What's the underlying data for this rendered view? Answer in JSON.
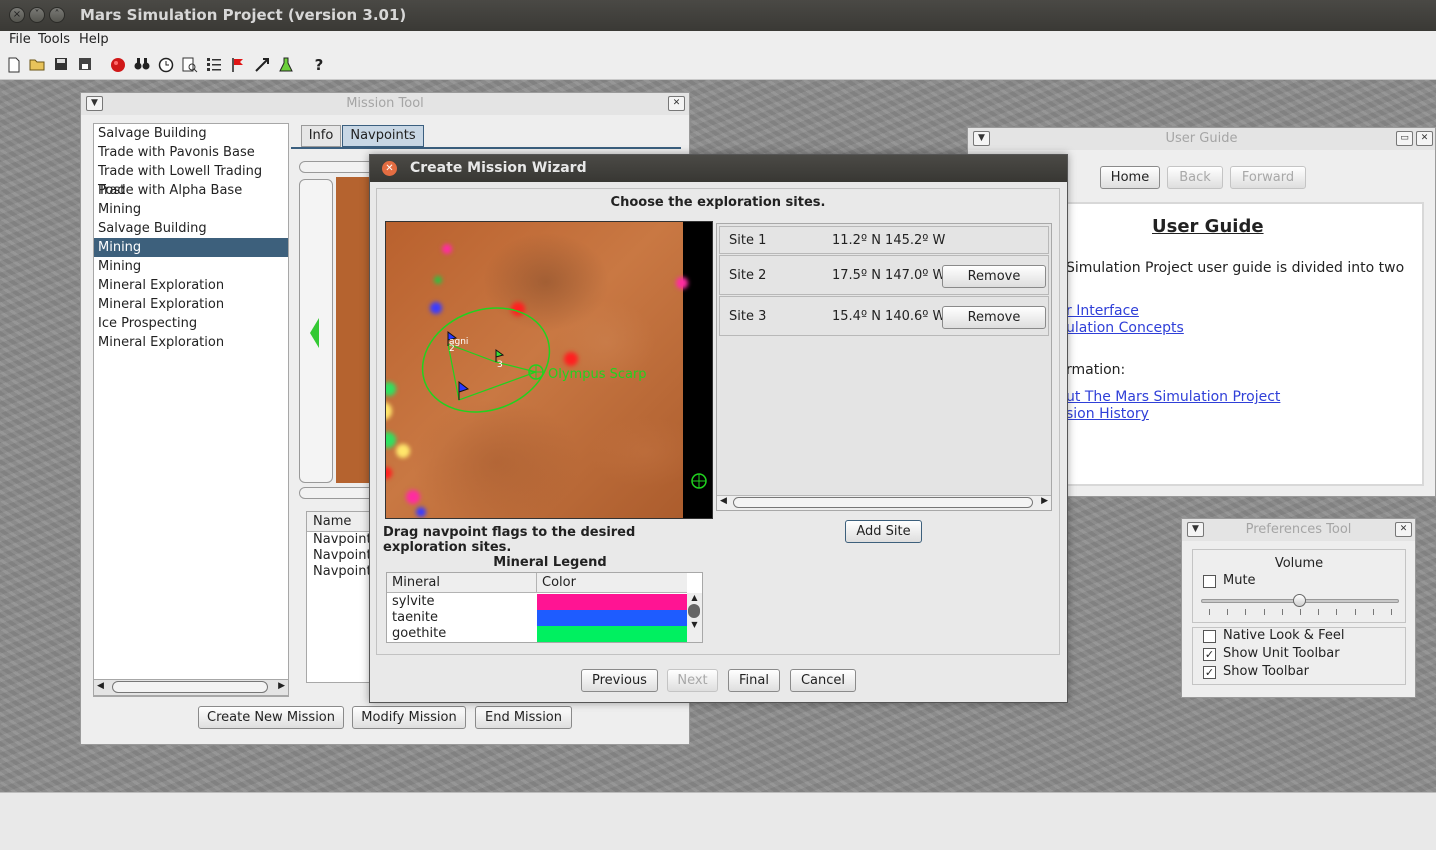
{
  "window": {
    "title": "Mars Simulation Project (version 3.01)"
  },
  "menu": [
    "File",
    "Tools",
    "Help"
  ],
  "toolbar_icons": [
    "new-file-icon",
    "open-folder-icon",
    "save-icon",
    "save-as-icon",
    "mars-globe-icon",
    "binoculars-icon",
    "clock-icon",
    "search-document-icon",
    "list-icon",
    "flag-icon",
    "science-icon",
    "flask-icon",
    "help-icon"
  ],
  "mission_tool": {
    "title": "Mission Tool",
    "missions": [
      "Salvage Building",
      "Trade with Pavonis Base",
      "Trade with Lowell Trading Post",
      "Trade with Alpha Base",
      "Mining",
      "Salvage Building",
      "Mining",
      "Mining",
      "Mineral Exploration",
      "Mineral Exploration",
      "Ice Prospecting",
      "Mineral Exploration"
    ],
    "selected_index": 6,
    "tabs": [
      "Info",
      "Navpoints"
    ],
    "table_header": "Name",
    "rows": [
      "Navpoint",
      "Navpoint",
      "Navpoint"
    ],
    "buttons": {
      "create": "Create New Mission",
      "modify": "Modify Mission",
      "end": "End Mission"
    }
  },
  "user_guide": {
    "title": "User Guide",
    "nav": {
      "home": "Home",
      "back": "Back",
      "forward": "Forward"
    },
    "heading": "User Guide",
    "intro": "Simulation Project user guide is divided into two",
    "link1": "r Interface",
    "link2": "ulation Concepts",
    "info_heading": "rmation:",
    "link3": "ut The Mars Simulation Project",
    "link4": "sion History"
  },
  "preferences": {
    "title": "Preferences Tool",
    "volume_label": "Volume",
    "mute": {
      "label": "Mute",
      "checked": false
    },
    "volume_level_percent": 50,
    "native_look": {
      "label": "Native Look & Feel",
      "checked": false
    },
    "unit_toolbar": {
      "label": "Show Unit Toolbar",
      "checked": true
    },
    "show_toolbar": {
      "label": "Show Toolbar",
      "checked": true
    }
  },
  "wizard": {
    "title": "Create Mission Wizard",
    "instruction": "Choose the exploration sites.",
    "map": {
      "label_agni": "agni",
      "label_olympus": "Olympus Scarp",
      "flag2": "2",
      "flag3": "3"
    },
    "drag_hint": "Drag navpoint flags to the desired exploration sites.",
    "legend_title": "Mineral Legend",
    "legend_headers": {
      "mineral": "Mineral",
      "color": "Color"
    },
    "legend": [
      {
        "name": "sylvite",
        "color": "#ff1493"
      },
      {
        "name": "taenite",
        "color": "#1e5cff"
      },
      {
        "name": "goethite",
        "color": "#00f060"
      }
    ],
    "sites": [
      {
        "name": "Site 1",
        "coords": "11.2º N 145.2º W",
        "removable": false
      },
      {
        "name": "Site 2",
        "coords": "17.5º N 147.0º W",
        "removable": true
      },
      {
        "name": "Site 3",
        "coords": "15.4º N 140.6º W",
        "removable": true
      }
    ],
    "remove_label": "Remove",
    "add_site": "Add Site",
    "buttons": {
      "previous": "Previous",
      "next": "Next",
      "final": "Final",
      "cancel": "Cancel"
    }
  }
}
